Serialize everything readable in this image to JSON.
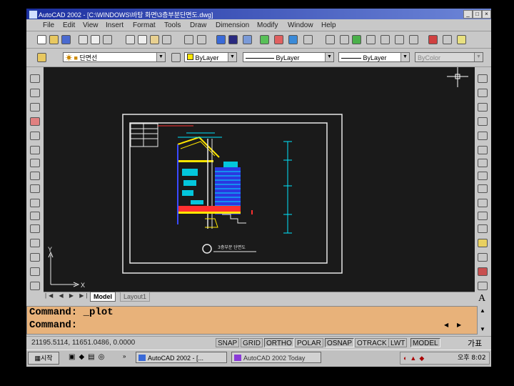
{
  "window": {
    "title": "AutoCAD 2002 - [C:\\WINDOWS\\바탕 화면\\3층부분단면도.dwg]",
    "controls": [
      "_",
      "□",
      "×"
    ]
  },
  "menu": [
    "File",
    "Edit",
    "View",
    "Insert",
    "Format",
    "Tools",
    "Draw",
    "Dimension",
    "Modify",
    "Window",
    "Help"
  ],
  "properties_bar": {
    "layer_value": "단면선",
    "color_value": "ByLayer",
    "linetype_value": "ByLayer",
    "lineweight_value": "ByLayer",
    "plotstyle_value": "ByColor"
  },
  "layout_tabs": [
    "Model",
    "Layout1"
  ],
  "command_lines": [
    "Command:  _plot",
    "Command:"
  ],
  "status": {
    "coordinates": "21195.5114, 11651.0486, 0.0000",
    "buttons": [
      {
        "label": "SNAP",
        "on": false
      },
      {
        "label": "GRID",
        "on": false
      },
      {
        "label": "ORTHO",
        "on": true
      },
      {
        "label": "POLAR",
        "on": false
      },
      {
        "label": "OSNAP",
        "on": true
      },
      {
        "label": "OTRACK",
        "on": false
      },
      {
        "label": "LWT",
        "on": false
      },
      {
        "label": "MODEL",
        "on": true
      }
    ],
    "tray_right": "가표"
  },
  "taskbar": {
    "start_label": "시작",
    "tasks": [
      "AutoCAD 2002 - [...",
      "AutoCAD 2002 Today"
    ],
    "clock": "오후 8:02"
  },
  "drawing": {
    "plan_title": "3층부분 단면도",
    "axis_x": "X",
    "axis_y": "Y"
  },
  "colors": {
    "canvas": "#1a1a1a",
    "command_bg": "#e8b27a",
    "title_bar": "#1c2fa0",
    "cyan": "#00e5ff",
    "yellow": "#ffe600",
    "red": "#ff3030",
    "blue": "#3a4aff"
  }
}
